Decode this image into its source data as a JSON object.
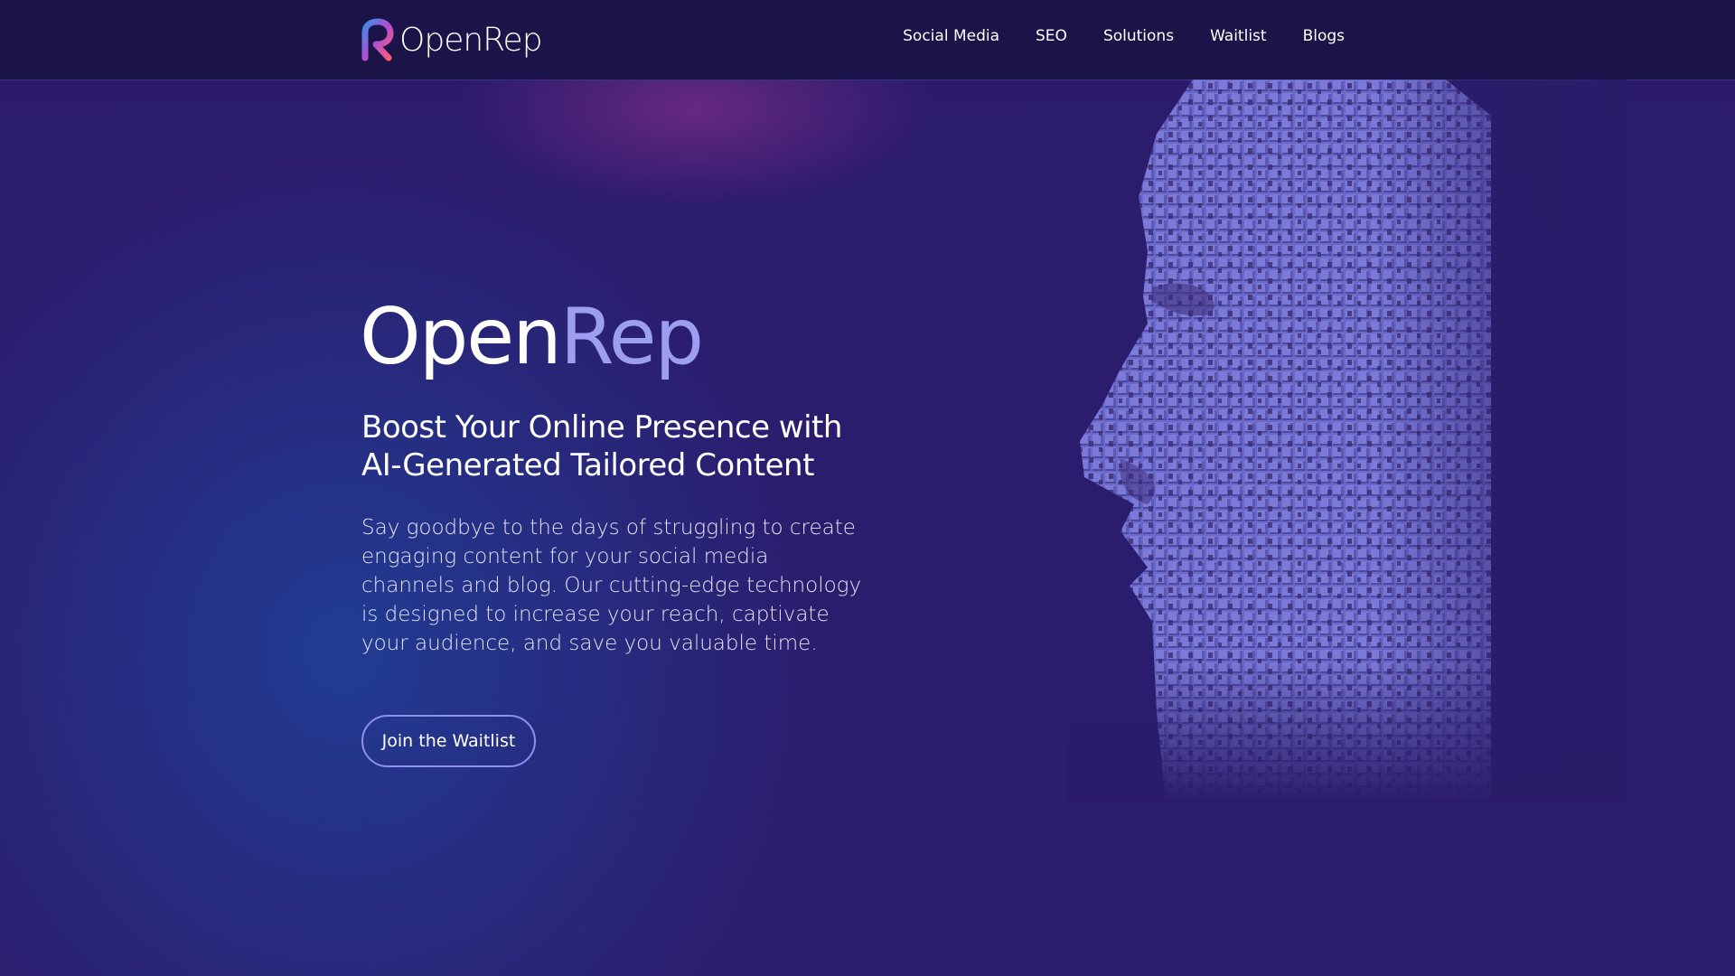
{
  "brand": {
    "name": "OpenRep",
    "colors": {
      "accent": "#9d9ef0",
      "navbar": "#1a1448",
      "background": "#2a1c69",
      "button_border": "#8f8ff0"
    }
  },
  "navbar": {
    "logo_text": "OpenRep",
    "items": [
      {
        "label": "Social Media"
      },
      {
        "label": "SEO"
      },
      {
        "label": "Solutions"
      },
      {
        "label": "Waitlist"
      },
      {
        "label": "Blogs"
      }
    ]
  },
  "hero": {
    "title_primary": "Open",
    "title_accent": "Rep",
    "subtitle": "Boost Your Online Presence with AI-Generated Tailored Content",
    "description": "Say goodbye to the days of struggling to create engaging content for your social media channels and blog. Our cutting-edge technology is designed to increase your reach, captivate your audience, and save you valuable time.",
    "cta_label": "Join the Waitlist",
    "image": "voxel-face-illustration"
  }
}
